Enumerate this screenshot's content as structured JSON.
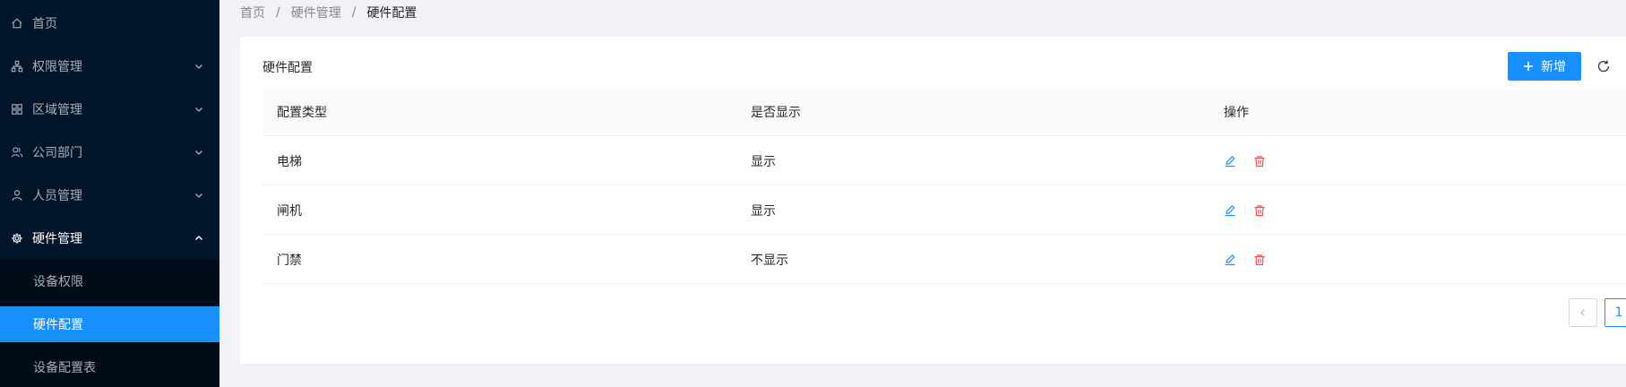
{
  "colors": {
    "sidebar_bg": "#001529",
    "submenu_bg": "#000c17",
    "primary": "#1890ff",
    "danger": "#ff4d4f"
  },
  "sidebar": {
    "items": [
      {
        "label": "首页",
        "icon": "home-icon"
      },
      {
        "label": "权限管理",
        "icon": "tree-icon"
      },
      {
        "label": "区域管理",
        "icon": "grid-icon"
      },
      {
        "label": "公司部门",
        "icon": "team-icon"
      },
      {
        "label": "人员管理",
        "icon": "user-icon"
      },
      {
        "label": "硬件管理",
        "icon": "gear-icon"
      }
    ],
    "sub_items": [
      {
        "label": "设备权限"
      },
      {
        "label": "硬件配置"
      },
      {
        "label": "设备配置表"
      }
    ]
  },
  "breadcrumb": [
    "首页",
    "硬件管理",
    "硬件配置"
  ],
  "card": {
    "title": "硬件配置",
    "add_label": "新增"
  },
  "table": {
    "columns": [
      "配置类型",
      "是否显示",
      "操作"
    ],
    "rows": [
      {
        "type": "电梯",
        "display": "显示"
      },
      {
        "type": "闸机",
        "display": "显示"
      },
      {
        "type": "门禁",
        "display": "不显示"
      }
    ]
  },
  "pagination": {
    "current": "1"
  }
}
